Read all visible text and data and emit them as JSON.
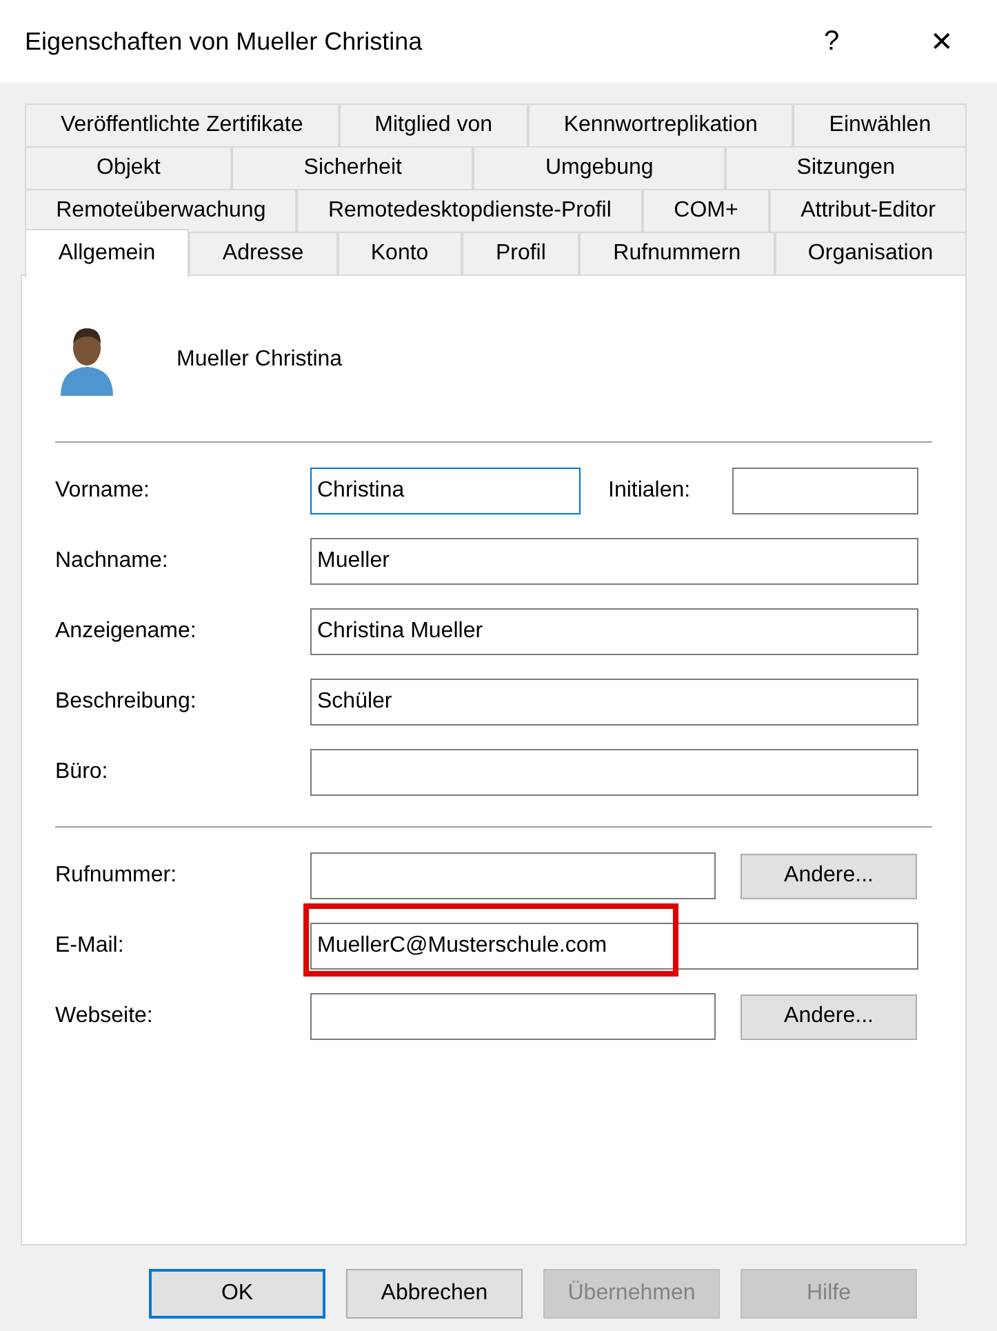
{
  "window": {
    "title": "Eigenschaften von Mueller Christina",
    "help_glyph": "?",
    "close_glyph": "✕"
  },
  "tab_rows": [
    [
      {
        "label": "Veröffentlichte Zertifikate",
        "selected": false
      },
      {
        "label": "Mitglied von",
        "selected": false
      },
      {
        "label": "Kennwortreplikation",
        "selected": false
      },
      {
        "label": "Einwählen",
        "selected": false
      }
    ],
    [
      {
        "label": "Objekt",
        "selected": false
      },
      {
        "label": "Sicherheit",
        "selected": false
      },
      {
        "label": "Umgebung",
        "selected": false
      },
      {
        "label": "Sitzungen",
        "selected": false
      }
    ],
    [
      {
        "label": "Remoteüberwachung",
        "selected": false
      },
      {
        "label": "Remotedesktopdienste-Profil",
        "selected": false
      },
      {
        "label": "COM+",
        "selected": false
      },
      {
        "label": "Attribut-Editor",
        "selected": false
      }
    ],
    [
      {
        "label": "Allgemein",
        "selected": true
      },
      {
        "label": "Adresse",
        "selected": false
      },
      {
        "label": "Konto",
        "selected": false
      },
      {
        "label": "Profil",
        "selected": false
      },
      {
        "label": "Rufnummern",
        "selected": false
      },
      {
        "label": "Organisation",
        "selected": false
      }
    ]
  ],
  "user": {
    "name": "Mueller Christina"
  },
  "sections": [
    [
      {
        "kind": "pair",
        "label": "Vorname:",
        "value": "Christina",
        "focused": true,
        "highlighted": false,
        "label2": "Initialen:"
      },
      {
        "kind": "text",
        "label": "Nachname:",
        "value": "Mueller",
        "focused": false,
        "highlighted": false
      },
      {
        "kind": "text",
        "label": "Anzeigename:",
        "value": "Christina Mueller",
        "focused": false,
        "highlighted": false
      },
      {
        "kind": "text",
        "label": "Beschreibung:",
        "value": "Schüler",
        "focused": false,
        "highlighted": false
      },
      {
        "kind": "text",
        "label": "Büro:",
        "focused": false,
        "highlighted": false
      }
    ],
    [
      {
        "kind": "button",
        "label": "Rufnummer:",
        "focused": false,
        "highlighted": false,
        "button": "Andere..."
      },
      {
        "kind": "text",
        "label": "E-Mail:",
        "value": "MuellerC@Musterschule.com",
        "focused": false,
        "highlighted": true
      },
      {
        "kind": "button",
        "label": "Webseite:",
        "focused": false,
        "highlighted": false,
        "button": "Andere..."
      }
    ]
  ],
  "buttons": [
    {
      "label": "OK",
      "default": true,
      "disabled": false
    },
    {
      "label": "Abbrechen",
      "default": false,
      "disabled": false
    },
    {
      "label": "Übernehmen",
      "default": false,
      "disabled": true
    },
    {
      "label": "Hilfe",
      "default": false,
      "disabled": true
    }
  ]
}
